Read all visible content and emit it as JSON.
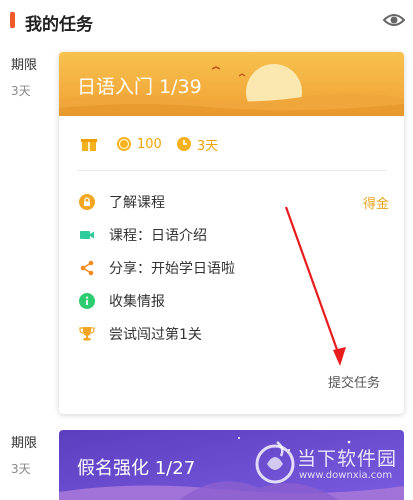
{
  "header": {
    "title": "我的任务",
    "accent_color": "#f05a28",
    "visibility_icon": "eye-icon"
  },
  "sections": [
    {
      "label": "期限",
      "duration": "3天"
    },
    {
      "label": "期限",
      "duration": "3天"
    }
  ],
  "card1": {
    "title": "日语入门 1/39",
    "banner_color": "#f2a533",
    "rewards": [
      {
        "icon": "gift-icon",
        "text": ""
      },
      {
        "icon": "coin-icon",
        "text": "100"
      },
      {
        "icon": "clock-icon",
        "text": "3天"
      }
    ],
    "tasks": [
      {
        "icon": "lock-icon",
        "icon_color": "#f5a623",
        "label": "了解课程",
        "reward": "得金"
      },
      {
        "icon": "video-icon",
        "icon_color": "#2ecc9a",
        "label": "课程：日语介绍",
        "reward": ""
      },
      {
        "icon": "share-icon",
        "icon_color": "#f58a23",
        "label": "分享：开始学日语啦",
        "reward": ""
      },
      {
        "icon": "info-icon",
        "icon_color": "#2ecc71",
        "label": "收集情报",
        "reward": ""
      },
      {
        "icon": "trophy-icon",
        "icon_color": "#f5a623",
        "label": "尝试闯过第1关",
        "reward": ""
      }
    ],
    "submit_label": "提交任务"
  },
  "card2": {
    "title": "假名强化 1/27",
    "banner_color": "#6b4fc9"
  },
  "watermark": {
    "text": "当下软件园",
    "url": "www.downxia.com"
  }
}
